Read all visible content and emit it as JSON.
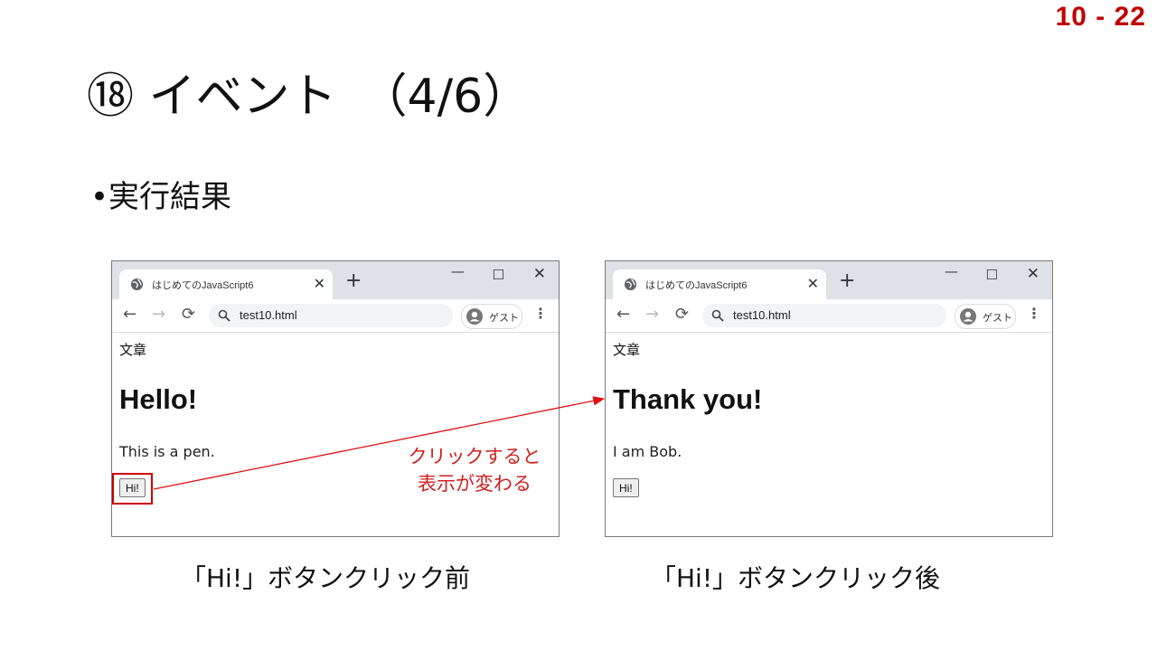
{
  "page_number": "10 - 22",
  "slide_title": "⑱ イベント　（4/6）",
  "bullet": "実行結果",
  "browser_before": {
    "tab_title": "はじめてのJavaScript6",
    "url": "test10.html",
    "profile_label": "ゲスト",
    "doc_title": "文章",
    "heading": "Hello!",
    "paragraph": "This is a pen.",
    "button_label": "Hi!"
  },
  "browser_after": {
    "tab_title": "はじめてのJavaScript6",
    "url": "test10.html",
    "profile_label": "ゲスト",
    "doc_title": "文章",
    "heading": "Thank you!",
    "paragraph": "I am Bob.",
    "button_label": "Hi!"
  },
  "annotation": {
    "line1": "クリックすると",
    "line2": "表示が変わる",
    "color": "#d02020"
  },
  "captions": {
    "before": "「Hi!」ボタンクリック前",
    "after": "「Hi!」ボタンクリック後"
  },
  "colors": {
    "accent": "#c00000",
    "tabbar": "#dee1e6"
  }
}
